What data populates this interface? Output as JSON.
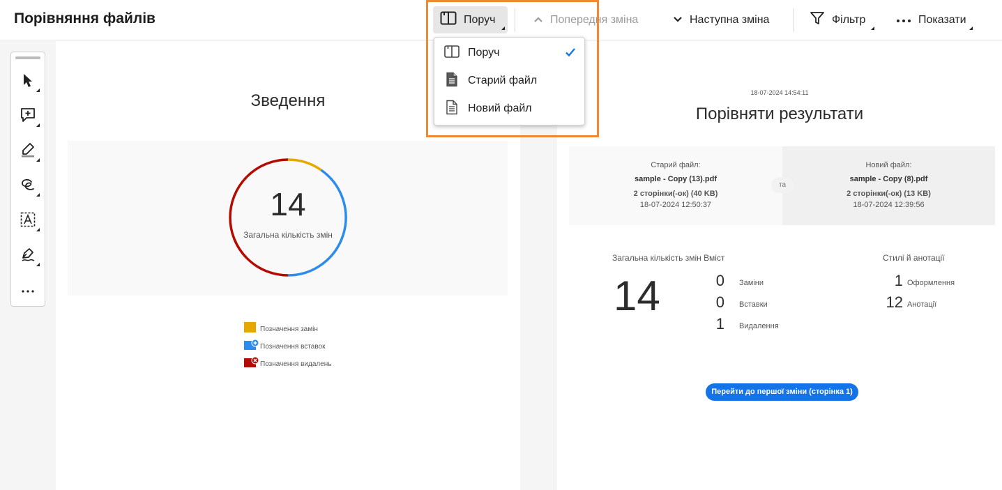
{
  "header": {
    "title": "Порівняння файлів",
    "view_button": "Поруч",
    "prev_change": "Попередня зміна",
    "next_change": "Наступна зміна",
    "filter": "Фільтр",
    "show": "Показати"
  },
  "view_menu": {
    "items": [
      {
        "label": "Поруч",
        "icon": "side-by-side-icon",
        "checked": true
      },
      {
        "label": "Старий файл",
        "icon": "old-file-icon",
        "checked": false
      },
      {
        "label": "Новий файл",
        "icon": "new-file-icon",
        "checked": false
      }
    ]
  },
  "tools": [
    "select-pointer-icon",
    "add-comment-icon",
    "highlight-pen-icon",
    "freehand-draw-icon",
    "text-recognition-icon",
    "fill-sign-icon",
    "more-tools-icon"
  ],
  "summary": {
    "title": "Зведення",
    "total": "14",
    "total_label": "Загальна кількість змін",
    "legend": [
      {
        "label": "Позначення замін",
        "color": "#e6a700"
      },
      {
        "label": "Позначення вставок",
        "color": "#2d8ceb"
      },
      {
        "label": "Позначення видалень",
        "color": "#b30b00"
      }
    ]
  },
  "compare": {
    "timestamp": "18-07-2024 14:54:11",
    "title": "Порівняти результати",
    "connector": "та",
    "old_file": {
      "caption": "Старий файл:",
      "name": "sample - Copy (13).pdf",
      "meta": "2 сторінки(-ок) (40 KB)",
      "date": "18-07-2024 12:50:37"
    },
    "new_file": {
      "caption": "Новий файл:",
      "name": "sample - Copy (8).pdf",
      "meta": "2 сторінки(-ок) (13 KB)",
      "date": "18-07-2024 12:39:56"
    },
    "content_heading": "Загальна кількість змін Вміст",
    "total": "14",
    "content_stats": [
      {
        "value": "0",
        "label": "Заміни"
      },
      {
        "value": "0",
        "label": "Вставки"
      },
      {
        "value": "1",
        "label": "Видалення"
      }
    ],
    "styles_heading": "Стилі й анотації",
    "style_stats": [
      {
        "value": "1",
        "label": "Оформлення"
      },
      {
        "value": "12",
        "label": "Анотації"
      }
    ],
    "goto_button": "Перейти до першої зміни (сторінка 1)"
  },
  "colors": {
    "accent": "#1473e6",
    "highlight": "#f08a32",
    "replace": "#e6a700",
    "insert": "#2d8ceb",
    "delete": "#b30b00"
  }
}
